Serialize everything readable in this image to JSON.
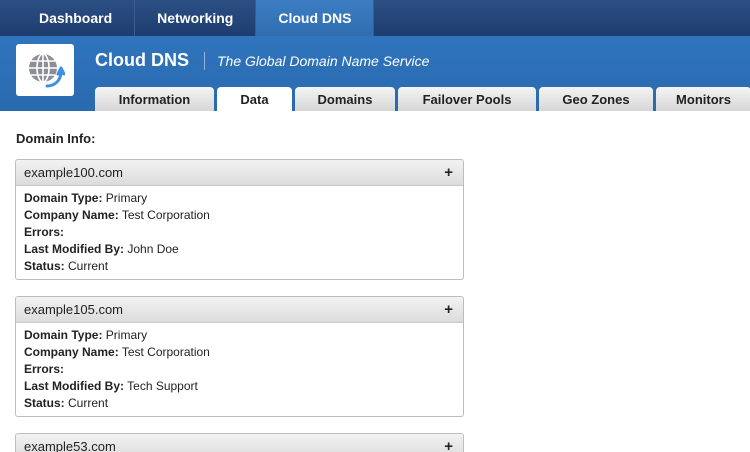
{
  "topnav": {
    "items": [
      {
        "label": "Dashboard"
      },
      {
        "label": "Networking"
      },
      {
        "label": "Cloud DNS"
      }
    ]
  },
  "header": {
    "title": "Cloud DNS",
    "subtitle": "The Global Domain Name Service"
  },
  "tabs": [
    {
      "label": "Information"
    },
    {
      "label": "Data"
    },
    {
      "label": "Domains"
    },
    {
      "label": "Failover Pools"
    },
    {
      "label": "Geo Zones"
    },
    {
      "label": "Monitors"
    }
  ],
  "main": {
    "section_label": "Domain Info:",
    "labels": {
      "domain_type": "Domain Type:",
      "company_name": "Company Name:",
      "errors": "Errors:",
      "last_modified_by": "Last Modified By:",
      "status": "Status:"
    },
    "expand_symbol": "+",
    "domains": [
      {
        "name": "example100.com",
        "domain_type": "Primary",
        "company_name": "Test Corporation",
        "errors": "",
        "last_modified_by": "John Doe",
        "status": "Current"
      },
      {
        "name": "example105.com",
        "domain_type": "Primary",
        "company_name": "Test Corporation",
        "errors": "",
        "last_modified_by": "Tech Support",
        "status": "Current"
      },
      {
        "name": "example53.com"
      }
    ]
  },
  "colors": {
    "nav_bar": "#1d3d6e",
    "nav_active": "#3c7ec2",
    "header_band": "#2f74bd",
    "tab_inactive": "#d6d6d6",
    "tab_active": "#ffffff"
  },
  "icons": {
    "logo": "globe-arrow-icon",
    "expand": "plus-icon"
  }
}
